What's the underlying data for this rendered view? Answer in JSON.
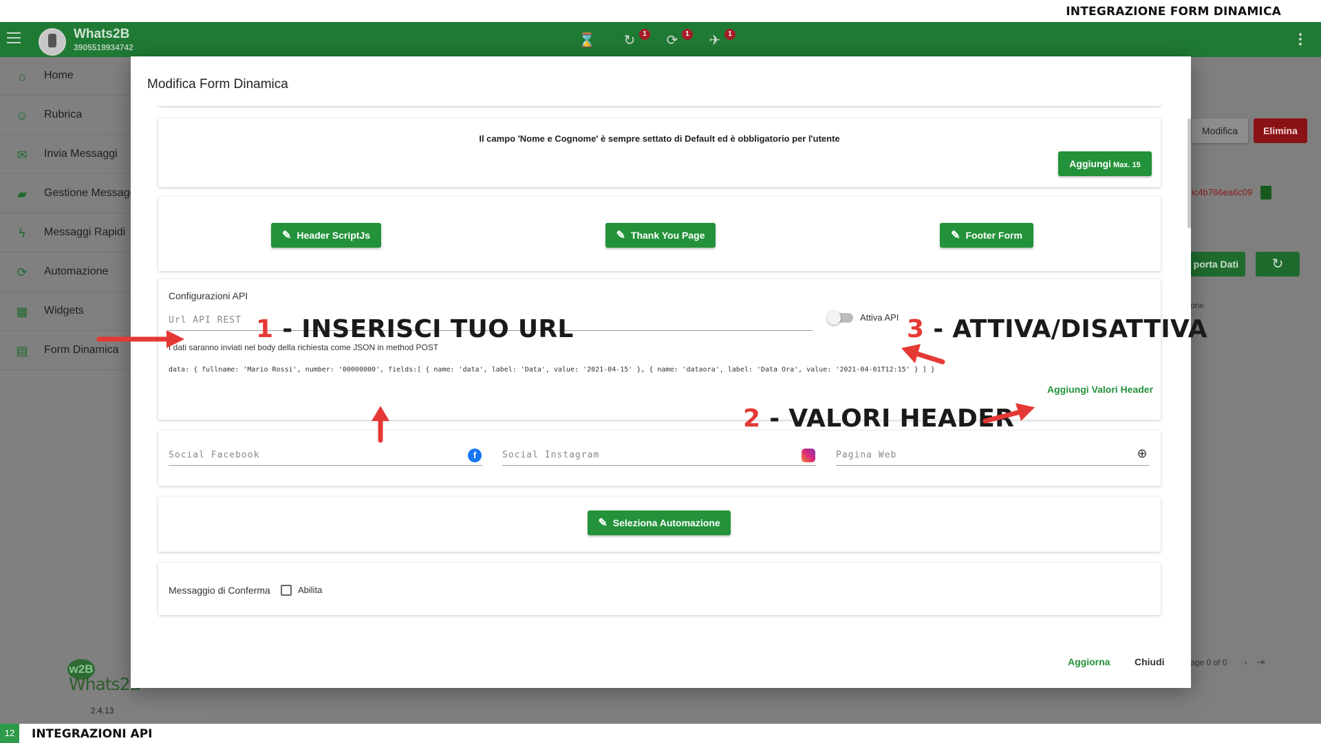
{
  "page": {
    "header_title": "INTEGRAZIONE FORM DINAMICA",
    "footer_title": "INTEGRAZIONI API",
    "page_number": "12"
  },
  "topbar": {
    "app_name": "Whats2B",
    "phone": "3905519934742",
    "icons": [
      {
        "name": "hourglass-icon",
        "glyph": "⌛",
        "badge": ""
      },
      {
        "name": "history-icon",
        "glyph": "↻",
        "badge": "1"
      },
      {
        "name": "sync-icon",
        "glyph": "⟳",
        "badge": "1"
      },
      {
        "name": "scheduled-send-icon",
        "glyph": "✈",
        "badge": "1"
      }
    ]
  },
  "sidebar": {
    "items": [
      {
        "label": "Home",
        "icon": "home-icon",
        "glyph": "⌂"
      },
      {
        "label": "Rubrica",
        "icon": "contacts-icon",
        "glyph": "☺"
      },
      {
        "label": "Invia Messaggi",
        "icon": "mail-icon",
        "glyph": "✉"
      },
      {
        "label": "Gestione Messaggi",
        "icon": "folder-icon",
        "glyph": "▰"
      },
      {
        "label": "Messaggi Rapidi",
        "icon": "flash-icon",
        "glyph": "ϟ"
      },
      {
        "label": "Automazione",
        "icon": "autorenew-icon",
        "glyph": "⟳"
      },
      {
        "label": "Widgets",
        "icon": "widgets-icon",
        "glyph": "▦"
      },
      {
        "label": "Form Dinamica",
        "icon": "form-icon",
        "glyph": "▤"
      }
    ],
    "logo_text": "Whats2B",
    "logo_mark": "w2B",
    "version": "2.4.13"
  },
  "background_panel": {
    "modifica_label": "Modifica",
    "elimina_label": "Elimina",
    "token_text": "ic4b766ea6c09",
    "export_label": "porta Dati",
    "small_text": "one",
    "pager_text": "age 0 of 0"
  },
  "modal": {
    "title": "Modifica Form Dinamica",
    "notice": "Il campo 'Nome e Cognome' è sempre settato di Default ed è obbligatorio per l'utente",
    "add_button": "Aggiungi",
    "add_button_max": "Max. 15",
    "buttons": {
      "header_script": "Header ScriptJs",
      "thank_you": "Thank You Page",
      "footer_form": "Footer Form"
    },
    "api": {
      "section_label": "Configurazioni API",
      "url_placeholder": "Url API REST",
      "toggle_label": "Attiva API",
      "toggle_on": false,
      "note": "I dati saranno inviati nel body della richiesta come JSON in method POST",
      "example": "data: { fullname: 'Mario Rossi', number: '00000000', fields:[ { name: 'data', label: 'Data', value: '2021-04-15' }, { name: 'dataora', label: 'Data Ora', value: '2021-04-01T12:15' } ] }",
      "add_header_link": "Aggiungi Valori Header"
    },
    "social": {
      "facebook_placeholder": "Social Facebook",
      "instagram_placeholder": "Social Instagram",
      "web_placeholder": "Pagina Web"
    },
    "automation_button": "Seleziona Automazione",
    "confirm": {
      "label": "Messaggio di Conferma",
      "checkbox_label": "Abilita",
      "checked": false
    },
    "footer": {
      "update": "Aggiorna",
      "close": "Chiudi"
    }
  },
  "annotations": {
    "a1_num": "1",
    "a1_text": " - INSERISCI TUO URL",
    "a2_num": "2",
    "a2_text": " - VALORI HEADER",
    "a3_num": "3",
    "a3_text": " - ATTIVA/DISATTIVA"
  },
  "colors": {
    "brand_green": "#23923a",
    "annotation_red": "#e53935",
    "danger": "#c62828"
  }
}
